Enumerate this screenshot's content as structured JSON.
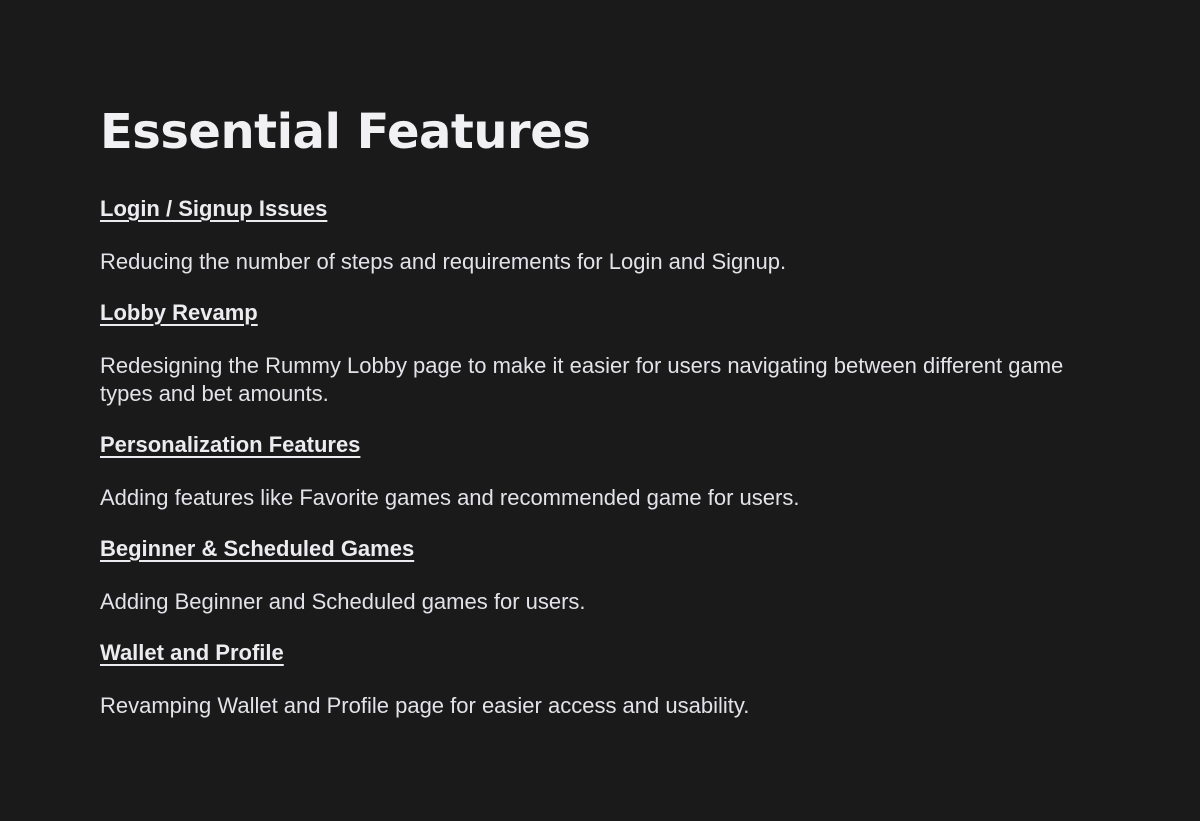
{
  "page": {
    "title": "Essential Features"
  },
  "features": [
    {
      "heading": "Login / Signup Issues",
      "description": "Reducing the number of steps and requirements for Login and Signup."
    },
    {
      "heading": "Lobby Revamp",
      "description": "Redesigning the Rummy Lobby page to make it easier for users navigating between different game types and bet amounts."
    },
    {
      "heading": "Personalization Features",
      "description": "Adding features like Favorite games and recommended game for users."
    },
    {
      "heading": "Beginner & Scheduled Games",
      "description": "Adding Beginner and Scheduled games for users."
    },
    {
      "heading": "Wallet and Profile",
      "description": "Revamping Wallet and Profile page for easier access and usability."
    }
  ]
}
